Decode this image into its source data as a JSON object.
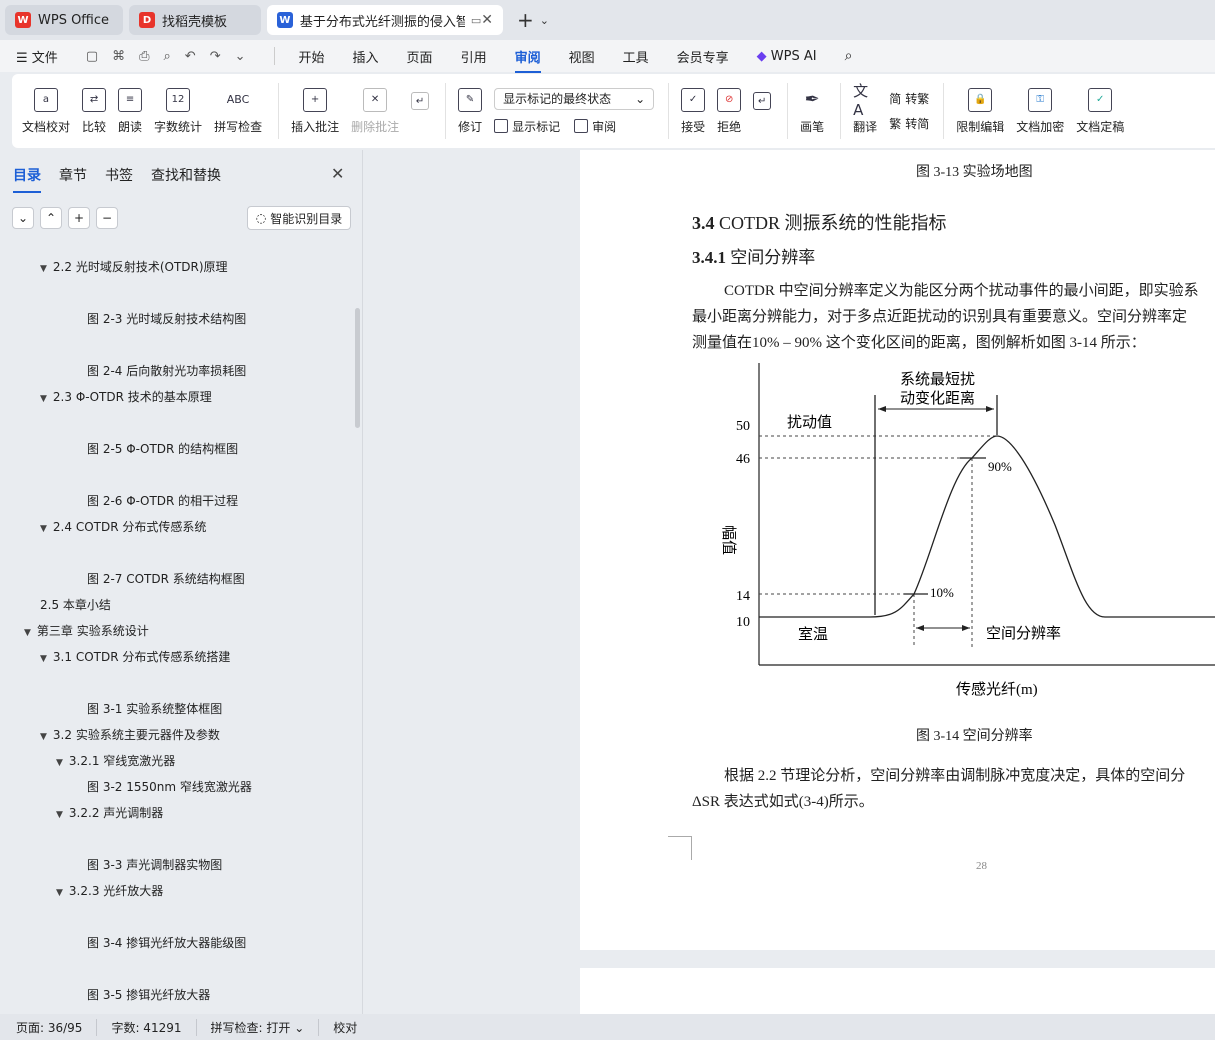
{
  "tabs": [
    {
      "label": "WPS Office",
      "logo": "W",
      "color": "#e8342b"
    },
    {
      "label": "找稻壳模板",
      "logo": "D",
      "color": "#e8342b"
    },
    {
      "label": "基于分布式光纤测振的侵入智能",
      "logo": "W",
      "color": "#2a62d8"
    }
  ],
  "menu": {
    "file": "文件",
    "items": [
      "开始",
      "插入",
      "页面",
      "引用",
      "审阅",
      "视图",
      "工具",
      "会员专享"
    ],
    "active": "审阅",
    "ai": "WPS AI"
  },
  "ribbon": {
    "doc_check": "文档校对",
    "compare": "比较",
    "read_aloud": "朗读",
    "word_count": "字数统计",
    "spell_check": "拼写检查",
    "insert_comment": "插入批注",
    "delete_comment": "删除批注",
    "revise": "修订",
    "markup_state": "显示标记的最终状态",
    "show_markup": "显示标记",
    "review": "审阅",
    "accept": "接受",
    "reject": "拒绝",
    "draw": "画笔",
    "translate": "翻译",
    "to_traditional": "转繁",
    "to_simplified": "转简",
    "restrict_edit": "限制编辑",
    "encrypt": "文档加密",
    "finalize": "文档定稿"
  },
  "left_panel": {
    "tabs": [
      "目录",
      "章节",
      "书签",
      "查找和替换"
    ],
    "active_tab": "目录",
    "smart_toc": "智能识别目录",
    "toc": [
      {
        "text": "2.2  光时域反射技术(OTDR)原理",
        "level": 1,
        "arrow": true
      },
      {
        "text": "图 2-3  光时域反射技术结构图",
        "level": 3,
        "arrow": false
      },
      {
        "text": "图 2-4  后向散射光功率损耗图",
        "level": 3,
        "arrow": false
      },
      {
        "text": "2.3 Φ-OTDR 技术的基本原理",
        "level": 1,
        "arrow": true
      },
      {
        "text": "图 2-5 Φ-OTDR 的结构框图",
        "level": 3,
        "arrow": false
      },
      {
        "text": "图 2-6 Φ-OTDR 的相干过程",
        "level": 3,
        "arrow": false
      },
      {
        "text": "2.4 COTDR 分布式传感系统",
        "level": 1,
        "arrow": true
      },
      {
        "text": "图 2-7 COTDR 系统结构框图",
        "level": 3,
        "arrow": false
      },
      {
        "text": "2.5  本章小结",
        "level": 1,
        "arrow": false
      },
      {
        "text": "第三章  实验系统设计",
        "level": 0,
        "arrow": true
      },
      {
        "text": "3.1 COTDR 分布式传感系统搭建",
        "level": 1,
        "arrow": true
      },
      {
        "text": "图 3-1  实验系统整体框图",
        "level": 3,
        "arrow": false
      },
      {
        "text": "3.2  实验系统主要元器件及参数",
        "level": 1,
        "arrow": true
      },
      {
        "text": "3.2.1  窄线宽激光器",
        "level": 2,
        "arrow": true
      },
      {
        "text": "图 3-2 1550nm 窄线宽激光器",
        "level": 3,
        "arrow": false
      },
      {
        "text": "3.2.2  声光调制器",
        "level": 2,
        "arrow": true
      },
      {
        "text": "图 3-3  声光调制器实物图",
        "level": 3,
        "arrow": false
      },
      {
        "text": "3.2.3  光纤放大器",
        "level": 2,
        "arrow": true
      },
      {
        "text": "图 3-4  掺铒光纤放大器能级图",
        "level": 3,
        "arrow": false
      },
      {
        "text": "图 3-5  掺铒光纤放大器",
        "level": 3,
        "arrow": false
      }
    ]
  },
  "document": {
    "caption_top": "图 3-13  实验场地图",
    "heading_34_num": "3.4",
    "heading_34_text": " COTDR 测振系统的性能指标",
    "heading_341_num": "3.4.1",
    "heading_341_text": "  空间分辨率",
    "para1": [
      "COTDR 中空间分辨率定义为能区分两个扰动事件的最小间距，即实验系",
      "最小距离分辨能力，对于多点近距扰动的识别具有重要意义。空间分辨率定",
      "测量值在10% – 90% 这个变化区间的距离，图例解析如图 3-14 所示："
    ],
    "figure": {
      "title_line1": "系统最短扰",
      "title_line2": "动变化距离",
      "disturb": "扰动值",
      "room_temp": "室温",
      "spatial_res": "空间分辨率",
      "ylabel": "幅值",
      "xlabel": "传感光纤(m)",
      "pct90": "90%",
      "pct10": "10%",
      "yticks": [
        "50",
        "46",
        "14",
        "10"
      ]
    },
    "caption_fig": "图 3-14  空间分辨率",
    "para2": [
      "根据 2.2 节理论分析，空间分辨率由调制脉冲宽度决定，具体的空间分",
      "ΔSR 表达式如式(3-4)所示。"
    ],
    "page_number": "28"
  },
  "status": {
    "page": "页面: 36/95",
    "words": "字数: 41291",
    "spell": "拼写检查: 打开",
    "proof": "校对"
  }
}
